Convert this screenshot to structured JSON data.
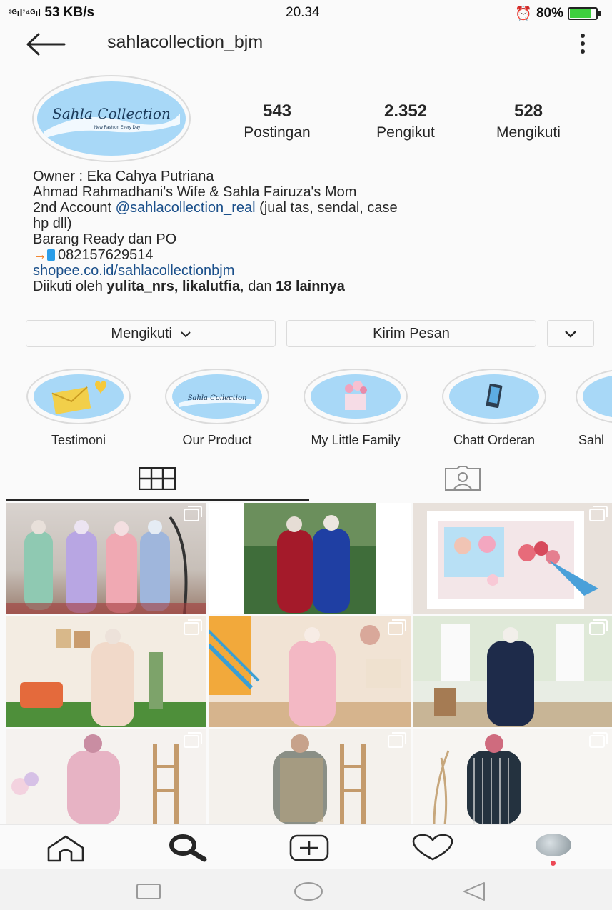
{
  "status_bar": {
    "signal": "³ᴳıl’⁴ᴳıl",
    "speed": "53 KB/s",
    "time": "20.34",
    "battery": "80%"
  },
  "header": {
    "username": "sahlacollection_bjm"
  },
  "profile": {
    "avatar_text": "Sahla Collection",
    "avatar_tagline": "New Fashion Every Day"
  },
  "stats": [
    {
      "num": "543",
      "label": "Postingan"
    },
    {
      "num": "2.352",
      "label": "Pengikut"
    },
    {
      "num": "528",
      "label": "Mengikuti"
    }
  ],
  "bio": {
    "line1": "Owner : Eka Cahya Putriana",
    "line2": "Ahmad Rahmadhani's Wife & Sahla Fairuza's Mom",
    "line3_pre": "2nd Account ",
    "line3_link": "@sahlacollection_real",
    "line3_post": " (jual tas, sendal, case",
    "line4": "hp dll)",
    "line5": "Barang Ready dan PO",
    "line6": "082157629514",
    "website": "shopee.co.id/sahlacollectionbjm",
    "followed_pre": "Diikuti oleh ",
    "followed_names": "yulita_nrs, likalutfia",
    "followed_mid": ", dan ",
    "followed_others": "18 lainnya"
  },
  "buttons": {
    "following": "Mengikuti",
    "message": "Kirim Pesan"
  },
  "highlights": [
    {
      "label": "Testimoni"
    },
    {
      "label": "Our Product"
    },
    {
      "label": "My Little Family"
    },
    {
      "label": "Chatt Orderan"
    },
    {
      "label": "Sahl"
    }
  ],
  "colors": {
    "accent_link": "#1a4f8a",
    "highlight_bg": "#a8d8f7",
    "notification_dot": "#ed4956"
  }
}
